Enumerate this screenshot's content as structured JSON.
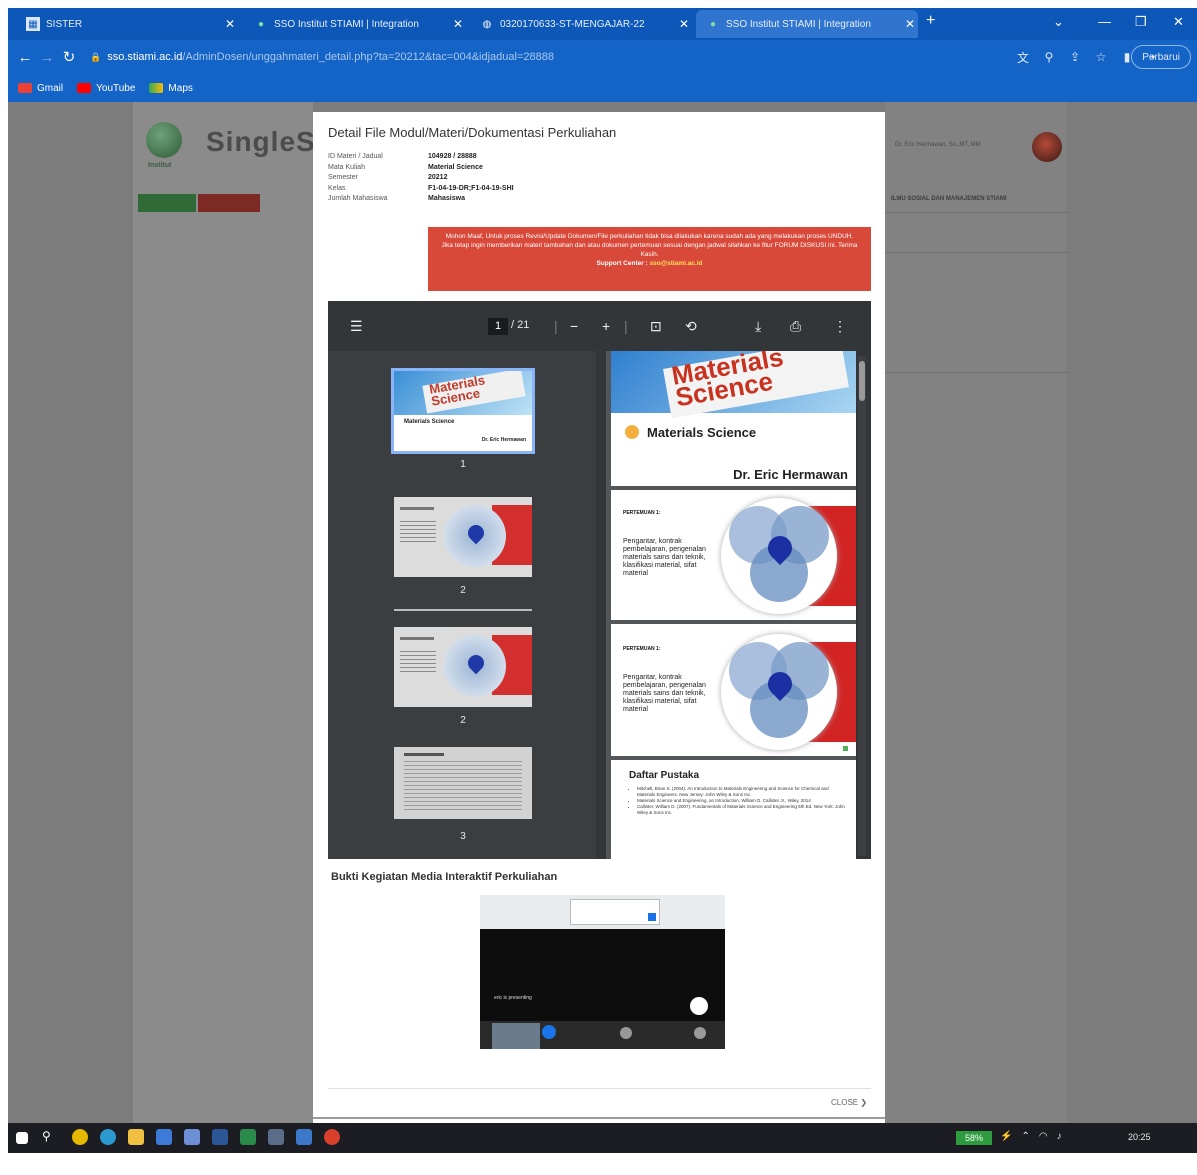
{
  "browser": {
    "tabs": [
      {
        "label": "SISTER",
        "icon": "sister-favicon"
      },
      {
        "label": "SSO Institut STIAMI | Integration",
        "icon": "sso-favicon"
      },
      {
        "label": "0320170633-ST-MENGAJAR-22",
        "icon": "globe-favicon"
      },
      {
        "label": "SSO Institut STIAMI | Integration",
        "icon": "sso-favicon",
        "active": true
      }
    ],
    "url_domain": "sso.stiami.ac.id",
    "url_path": "/AdminDosen/unggahmateri_detail.php?ta=20212&tac=004&idjadual=28888",
    "profile_label": "Perbarui",
    "bookmarks": [
      {
        "label": "Gmail",
        "color": "#ea4335"
      },
      {
        "label": "YouTube",
        "color": "#ff0000"
      },
      {
        "label": "Maps",
        "color": "#34a853"
      }
    ]
  },
  "background_page": {
    "logo_text": "SingleS",
    "logo_sub": "Institut",
    "user_name": "Dr. Eric Hermawan, Sn.,MT.,MM",
    "heading": "ILMU SOSIAL DAN MANAJEMEN STIAMI"
  },
  "modal": {
    "title": "Detail File Modul/Materi/Dokumentasi Perkuliahan",
    "info": [
      {
        "key": "ID Materi / Jadual",
        "value": "104928 / 28888"
      },
      {
        "key": "Mata Kuliah",
        "value": "Material Science"
      },
      {
        "key": "Semester",
        "value": "20212"
      },
      {
        "key": "Kelas",
        "value": "F1-04-19-DR;F1-04-19-SHI"
      },
      {
        "key": "Jumlah Mahasiswa",
        "value": "Mahasiswa"
      }
    ],
    "alert": {
      "line1": "Mohon Maaf, Untuk proses Revisi/Update Dokumen/File perkuliahan tidak bisa dilakukan karena sudah ada yang melakukan proses UNDUH.",
      "line2": "Jika tetap ingin memberikan materi tambahan dan atau dokumen pertemuan sesuai dengan jadwal silahkan ke fitur FORUM DISKUSI ini. Terima Kasih.",
      "support_label": "Support Center :",
      "support_email": "sso@stiami.ac.id"
    },
    "pdf": {
      "current_page": "1",
      "total_pages": "/ 21",
      "thumbnails": [
        {
          "num": "1",
          "kind": "cover"
        },
        {
          "num": "2",
          "kind": "venn"
        },
        {
          "num": "2",
          "kind": "venn"
        },
        {
          "num": "3",
          "kind": "text"
        }
      ],
      "cover": {
        "banner_line1": "Materials",
        "banner_line2": "Science",
        "subject": "Materials Science",
        "author": "Dr. Eric Hermawan"
      },
      "slide2": {
        "heading": "PERTEMUAN 1:",
        "body": "Pengantar, kontrak pembelajaran, pengenalan materials sains dan teknik, klasifikasi material, sifat material"
      },
      "slide3": {
        "heading": "PERTEMUAN 1:",
        "body": "Pengantar, kontrak pembelajaran, pengenalan materials sains dan teknik, klasifikasi material, sifat material"
      },
      "slide4": {
        "heading": "Daftar Pustaka",
        "items": [
          "Mitchell, Brian S. (2004). An Introduction to Materials Engineering and Science for Chemical and Materials Engineers. New Jersey: John Wiley & Sons Inc.",
          "Materials Science and Engineering, an Introduction, William D. Callister Jr., Wiley, 2014",
          "Callister, William D. (2007). Fundamentals of Materials Science and Engineering 5th Ed. New York: John Wiley & Sons Inc."
        ]
      }
    },
    "bukti_title": "Bukti Kegiatan Media Interaktif Perkuliahan",
    "bukti_caption": "eric is presenting",
    "close_label": "CLOSE"
  },
  "taskbar": {
    "battery": "58%",
    "clock": "20:25"
  }
}
